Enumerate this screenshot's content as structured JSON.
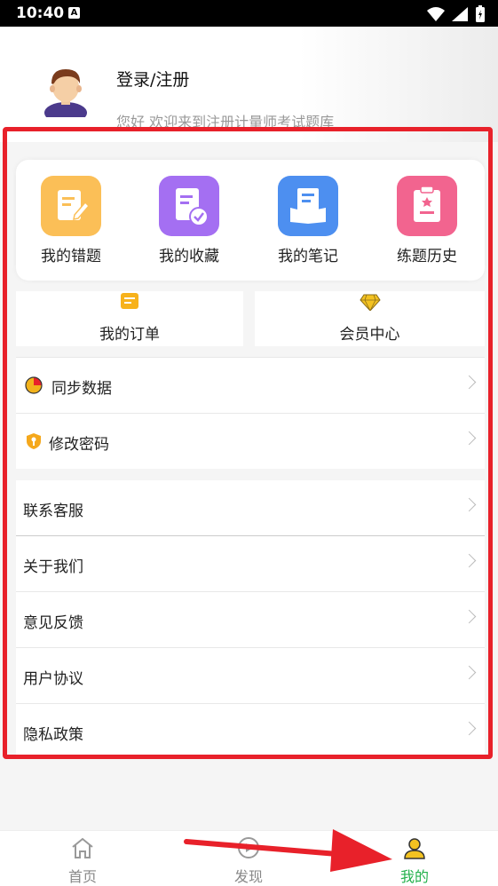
{
  "status": {
    "time": "10:40",
    "app_icon_letter": "A"
  },
  "header": {
    "login": "登录/注册",
    "welcome": "您好 欢迎来到注册计量师考试题库"
  },
  "grid": [
    {
      "label": "我的错题",
      "icon": "edit-note-icon",
      "color": "#fbbf57"
    },
    {
      "label": "我的收藏",
      "icon": "favorite-doc-icon",
      "color": "#a46ff2"
    },
    {
      "label": "我的笔记",
      "icon": "notebook-icon",
      "color": "#4d8ff0"
    },
    {
      "label": "练题历史",
      "icon": "clipboard-history-icon",
      "color": "#f2648f"
    }
  ],
  "split": [
    {
      "label": "我的订单",
      "icon": "order-icon"
    },
    {
      "label": "会员中心",
      "icon": "diamond-icon"
    }
  ],
  "menu1": [
    {
      "label": "同步数据",
      "icon": "sync-pie-icon"
    },
    {
      "label": "修改密码",
      "icon": "shield-key-icon"
    }
  ],
  "menu2": [
    {
      "label": "联系客服"
    },
    {
      "label": "关于我们"
    },
    {
      "label": "意见反馈"
    },
    {
      "label": "用户协议"
    },
    {
      "label": "隐私政策"
    }
  ],
  "tabs": [
    {
      "label": "首页",
      "icon": "home-icon"
    },
    {
      "label": "发现",
      "icon": "compass-icon"
    },
    {
      "label": "我的",
      "icon": "user-icon",
      "active": true
    }
  ],
  "colors": {
    "accent": "#22b04b",
    "highlight_frame": "#e8212a"
  }
}
